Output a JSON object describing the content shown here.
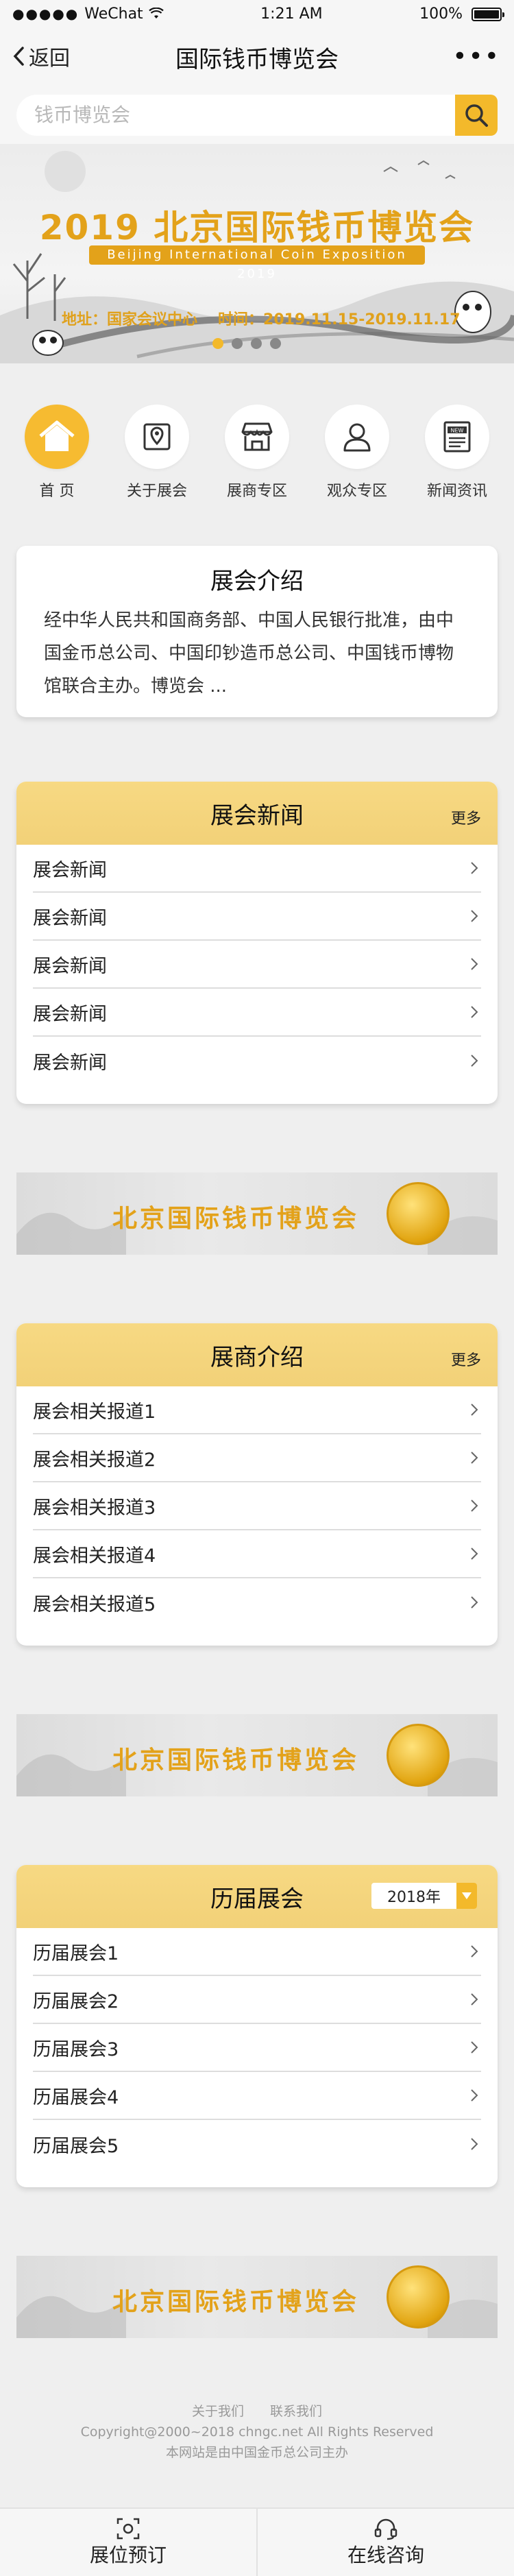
{
  "status_bar": {
    "carrier": "WeChat",
    "time": "1:21 AM",
    "battery": "100%"
  },
  "nav": {
    "back_label": "返回",
    "title": "国际钱币博览会"
  },
  "search": {
    "placeholder": "钱币博览会"
  },
  "banner": {
    "title": "2019 北京国际钱币博览会",
    "subtitle": "Beijing International Coin Exposition 2019",
    "address_label": "地址：国家会议中心",
    "time_label": "时间：2019.11.15-2019.11.17",
    "dot_count": 4,
    "active_dot": 0
  },
  "icon_nav": [
    {
      "label": "首 页",
      "icon": "home-icon",
      "active": true
    },
    {
      "label": "关于展会",
      "icon": "map-pin-icon",
      "active": false
    },
    {
      "label": "展商专区",
      "icon": "storefront-icon",
      "active": false
    },
    {
      "label": "观众专区",
      "icon": "user-icon",
      "active": false
    },
    {
      "label": "新闻资讯",
      "icon": "news-icon",
      "active": false
    }
  ],
  "intro": {
    "title": "展会介绍",
    "text": "经中华人民共和国商务部、中国人民银行批准，由中国金币总公司、中国印钞造币总公司、中国钱币博物馆联合主办。博览会 ..."
  },
  "news": {
    "title": "展会新闻",
    "more": "更多",
    "items": [
      "展会新闻",
      "展会新闻",
      "展会新闻",
      "展会新闻",
      "展会新闻"
    ]
  },
  "exhibitors": {
    "title": "展商介绍",
    "more": "更多",
    "items": [
      "展会相关报道1",
      "展会相关报道2",
      "展会相关报道3",
      "展会相关报道4",
      "展会相关报道5"
    ]
  },
  "past": {
    "title": "历届展会",
    "year": "2018年",
    "items": [
      "历届展会1",
      "历届展会2",
      "历届展会3",
      "历届展会4",
      "历届展会5"
    ]
  },
  "promo_banner": {
    "text": "北京国际钱币博览会"
  },
  "footer": {
    "link_about": "关于我们",
    "link_contact": "联系我们",
    "copyright": "Copyright@2000~2018 chngc.net All Rights Reserved",
    "sponsor": "本网站是由中国金币总公司主办"
  },
  "bottom_bar": {
    "booking": "展位预订",
    "consult": "在线咨询"
  },
  "colors": {
    "accent": "#f3b92b",
    "header_bg": "#f2d178",
    "banner_gold": "#e3a21a"
  }
}
